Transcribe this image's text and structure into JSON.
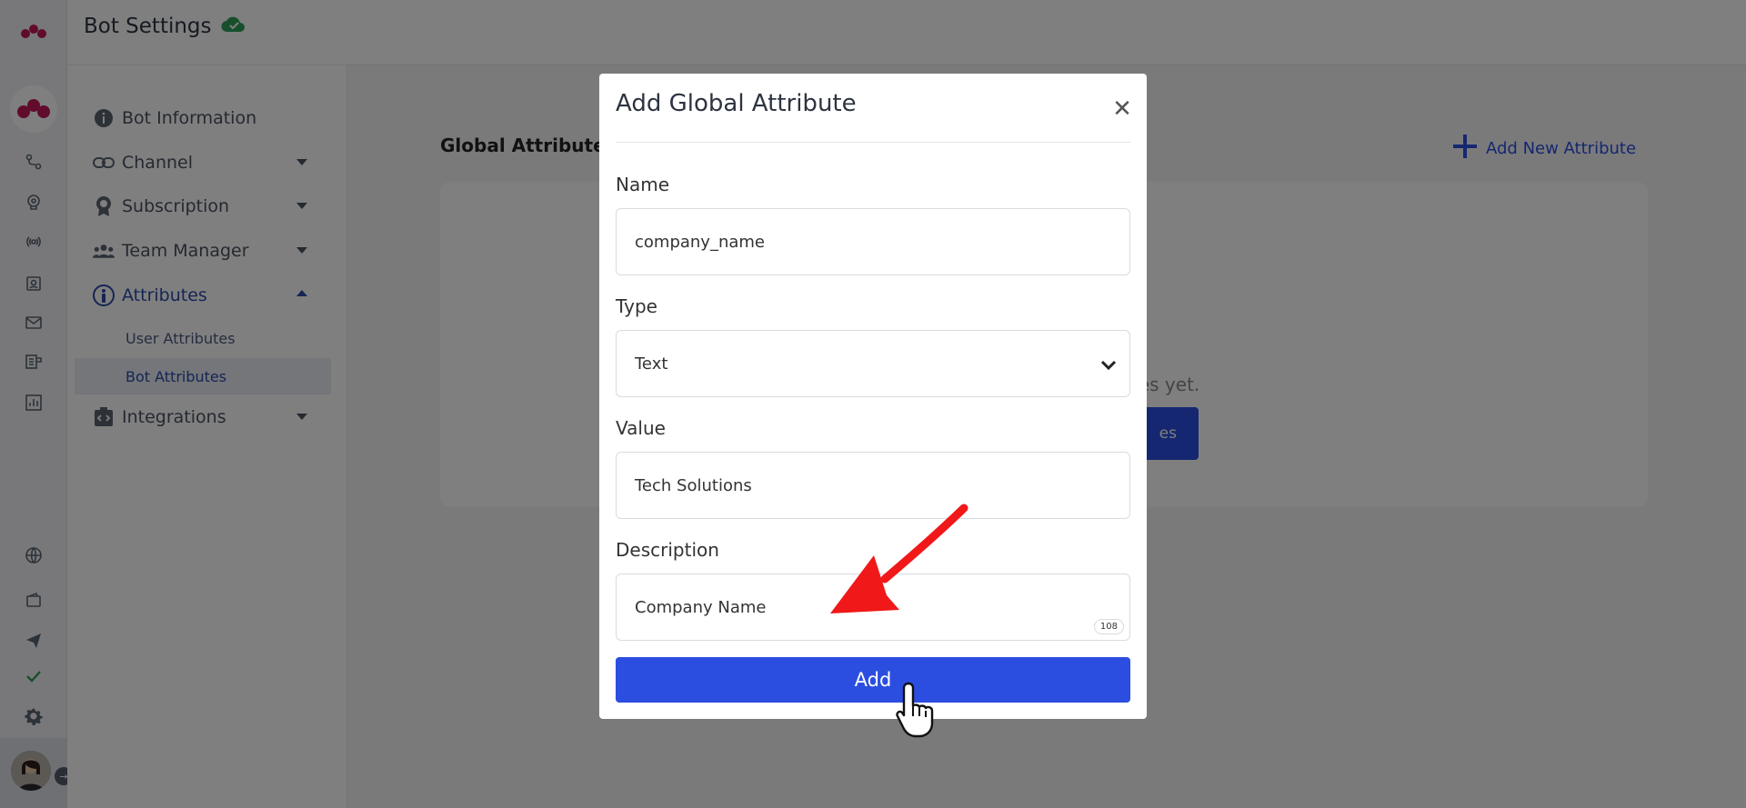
{
  "topbar": {
    "title": "Bot Settings",
    "status_icon": "cloud-check-icon",
    "status_color": "#2e9e5b"
  },
  "rail": {
    "icons": [
      "flow-icon",
      "brain-icon",
      "broadcast-icon",
      "contacts-icon",
      "mail-icon",
      "widget-icon",
      "analytics-icon",
      "globe-icon",
      "wallet-icon",
      "send-icon",
      "check-icon",
      "gear-icon"
    ],
    "accent": "#c2185b"
  },
  "sidebar": {
    "items": [
      {
        "label": "Bot Information",
        "icon": "info-icon"
      },
      {
        "label": "Channel",
        "icon": "link-icon"
      },
      {
        "label": "Subscription",
        "icon": "badge-icon"
      },
      {
        "label": "Team Manager",
        "icon": "team-icon"
      },
      {
        "label": "Attributes",
        "icon": "person-info-icon"
      },
      {
        "label": "Integrations",
        "icon": "code-icon"
      }
    ],
    "sub_items": [
      {
        "label": "User Attributes"
      },
      {
        "label": "Bot Attributes"
      }
    ]
  },
  "main": {
    "section_title": "Global Attribute",
    "add_new_label": "Add New Attribute",
    "empty_text": "tes yet.",
    "cta_label": "es"
  },
  "modal": {
    "title": "Add Global Attribute",
    "name_label": "Name",
    "name_value": "company_name",
    "type_label": "Type",
    "type_value": "Text",
    "value_label": "Value",
    "value_value": "Tech Solutions",
    "description_label": "Description",
    "description_value": "Company Name",
    "char_counter": "108",
    "add_label": "Add"
  },
  "colors": {
    "primary": "#2b4ee0",
    "annotation": "#f01818"
  }
}
